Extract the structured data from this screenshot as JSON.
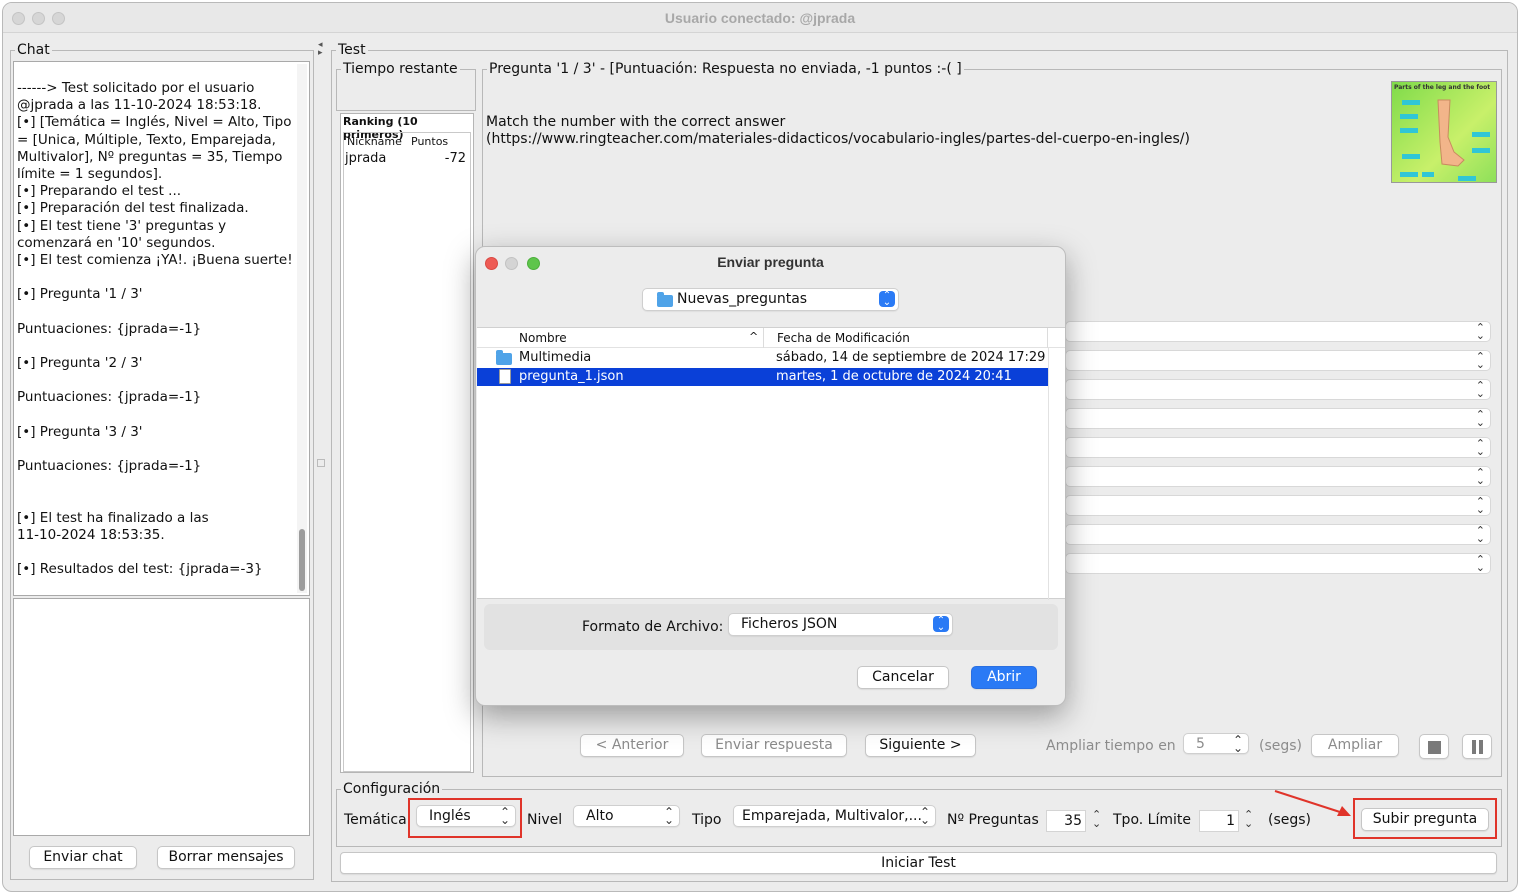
{
  "window": {
    "title": "Usuario conectado: @jprada"
  },
  "chat": {
    "title": "Chat",
    "lines": [
      "------> Test solicitado por el usuario",
      "@jprada a las 11-10-2024 18:53:18.",
      "[•] [Temática = Inglés, Nivel = Alto, Tipo",
      "= [Unica, Múltiple, Texto, Emparejada,",
      "Multivalor], Nº preguntas = 35, Tiempo",
      "límite = 1 segundos].",
      "[•] Preparando el test ...",
      "[•] Preparación del test finalizada.",
      "[•] El test tiene '3' preguntas y",
      "comenzará en '10' segundos.",
      "[•] El test comienza ¡YA!. ¡Buena suerte!",
      "",
      "[•] Pregunta '1 / 3'",
      "",
      "Puntuaciones: {jprada=-1}",
      "",
      "[•] Pregunta '2 / 3'",
      "",
      "Puntuaciones: {jprada=-1}",
      "",
      "[•] Pregunta '3 / 3'",
      "",
      "Puntuaciones: {jprada=-1}",
      "",
      "",
      "[•] El test ha finalizado a las",
      "11-10-2024 18:53:35.",
      "",
      "[•] Resultados del test: {jprada=-3}"
    ],
    "send_label": "Enviar chat",
    "clear_label": "Borrar mensajes"
  },
  "test": {
    "title": "Test",
    "time_left_label": "Tiempo restante",
    "ranking": {
      "title": "Ranking (10 primeros)",
      "col_nick": "Nickname",
      "col_points": "Puntos",
      "rows": [
        {
          "nick": "jprada",
          "points": "-72"
        }
      ]
    },
    "question": {
      "title": "Pregunta '1 / 3' - [Puntuación: Respuesta no enviada, -1 puntos :-( ]",
      "text_line1": "Match the number with the correct answer",
      "text_line2": "(https://www.ringteacher.com/materiales-didacticos/vocabulario-ingles/partes-del-cuerpo-en-ingles/)",
      "image_caption": "Parts of the leg and the foot"
    },
    "nav": {
      "prev": "< Anterior",
      "send": "Enviar respuesta",
      "next": "Siguiente >",
      "extend_label": "Ampliar tiempo en",
      "extend_value": "5",
      "secs": "(segs)",
      "extend_btn": "Ampliar"
    }
  },
  "config": {
    "title": "Configuración",
    "tematica_label": "Temática",
    "tematica_value": "Inglés",
    "nivel_label": "Nivel",
    "nivel_value": "Alto",
    "tipo_label": "Tipo",
    "tipo_value": "Emparejada, Multivalor,...",
    "npreg_label": "Nº Preguntas",
    "npreg_value": "35",
    "tpo_label": "Tpo. Límite",
    "tpo_value": "1",
    "secs": "(segs)",
    "upload_btn": "Subir pregunta",
    "start_btn": "Iniciar Test"
  },
  "dialog": {
    "title": "Enviar pregunta",
    "folder": "Nuevas_preguntas",
    "col_name": "Nombre",
    "col_date": "Fecha de Modificación",
    "files": [
      {
        "name": "Multimedia",
        "date": "sábado, 14 de septiembre de 2024 17:29",
        "icon": "folder-icon"
      },
      {
        "name": "pregunta_1.json",
        "date": "martes, 1 de octubre de 2024 20:41",
        "icon": "document-icon"
      }
    ],
    "format_label": "Formato de Archivo:",
    "format_value": "Ficheros JSON",
    "cancel": "Cancelar",
    "open": "Abrir"
  },
  "colors": {
    "accent": "#2a7af5",
    "selection": "#0a40d8",
    "highlight": "#e0342a"
  }
}
